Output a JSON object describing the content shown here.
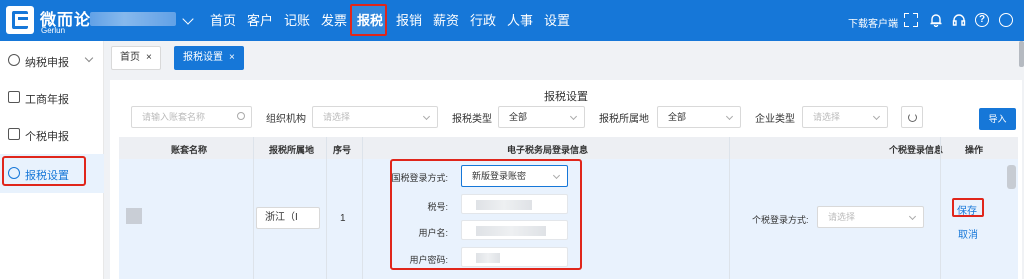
{
  "brand": {
    "name": "微而论",
    "sub": "Gerlun"
  },
  "topnav": {
    "items": [
      "首页",
      "客户",
      "记账",
      "发票",
      "报税",
      "报销",
      "薪资",
      "行政",
      "人事",
      "设置"
    ],
    "active": "报税",
    "download": "下载客户端"
  },
  "sidebar": {
    "items": [
      {
        "label": "纳税申报"
      },
      {
        "label": "工商年报"
      },
      {
        "label": "个税申报"
      },
      {
        "label": "报税设置"
      }
    ],
    "active": "报税设置"
  },
  "tabs": [
    {
      "label": "首页",
      "close": "×"
    },
    {
      "label": "报税设置",
      "close": "×"
    }
  ],
  "panel": {
    "title": "报税设置",
    "filters": {
      "account_placeholder": "请输入账套名称",
      "org_label": "组织机构",
      "org_placeholder": "请选择",
      "tax_type_label": "报税类型",
      "tax_type_value": "全部",
      "region_label": "报税所属地",
      "region_value": "全部",
      "company_type_label": "企业类型",
      "company_type_placeholder": "请选择"
    },
    "import_label": "导入"
  },
  "table": {
    "headers": {
      "account": "账套名称",
      "region": "报税所属地",
      "seq": "序号",
      "etax": "电子税务局登录信息",
      "personal": "个税登录信息",
      "op": "操作"
    },
    "row": {
      "region": "浙江（I",
      "seq": "1",
      "login_method_label": "国税登录方式:",
      "login_method_value": "新版登录账密",
      "tax_no_label": "税号:",
      "username_label": "用户名:",
      "password_label": "用户密码:",
      "personal_login_label": "个税登录方式:",
      "personal_login_placeholder": "请选择",
      "save": "保存",
      "cancel": "取消"
    }
  },
  "colors": {
    "primary": "#1677d8",
    "highlight": "#e0261b"
  }
}
